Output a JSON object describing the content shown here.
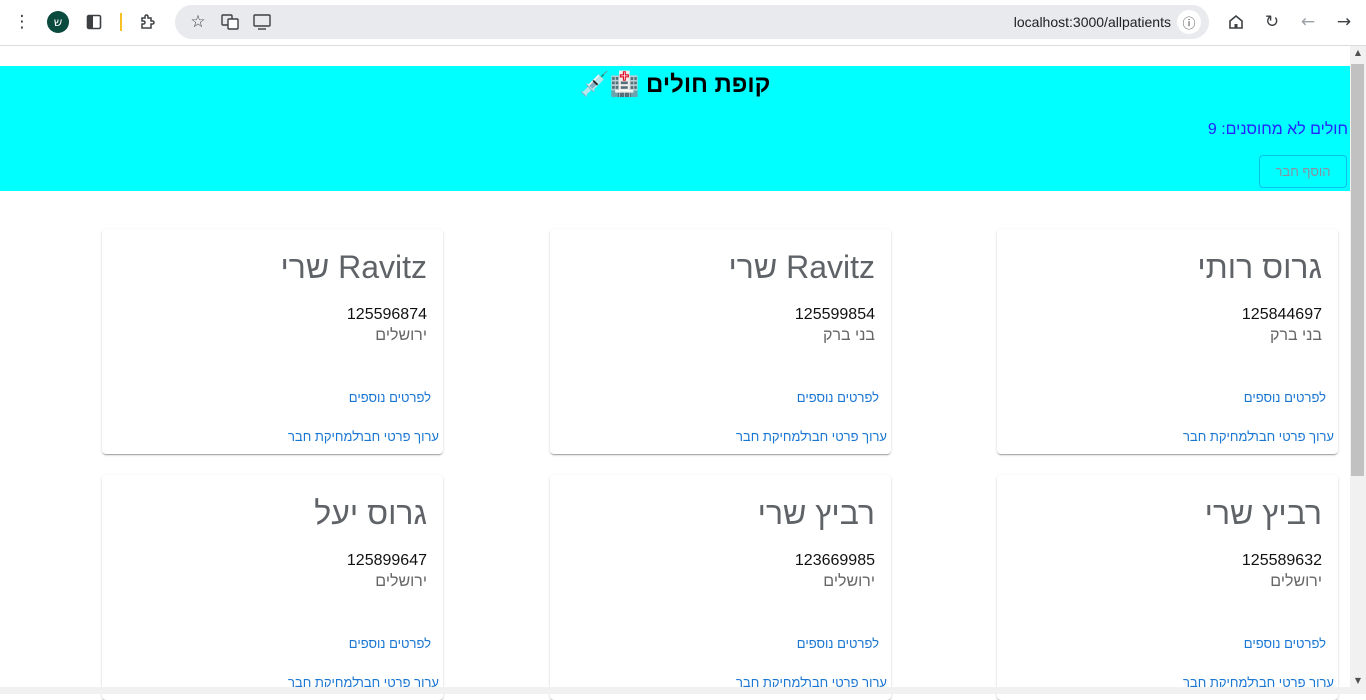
{
  "browser": {
    "url": "localhost:3000/allpatients",
    "profile_initial": "ש",
    "icons": [
      "menu-dots-icon",
      "profile-avatar",
      "sidebar-icon",
      "extensions-icon",
      "bookmark-star-icon",
      "translate-icon",
      "cast-icon",
      "info-icon",
      "home-icon",
      "reload-icon",
      "back-icon",
      "forward-icon"
    ]
  },
  "header": {
    "title": "קופת חולים 🏥💉",
    "unvaccinated_label": "חולים לא מחוסנים: 9",
    "add_button": "הוסף חבר",
    "background": "#00ffff"
  },
  "cards": [
    {
      "name": "גרוס רותי",
      "id": "125844697",
      "city": "בני ברק",
      "more": "לפרטים נוספים",
      "edit": "ערוך פרטי חבר",
      "delete": "למחיקת חבר"
    },
    {
      "name": "Ravitz שרי",
      "id": "125599854",
      "city": "בני ברק",
      "more": "לפרטים נוספים",
      "edit": "ערוך פרטי חבר",
      "delete": "למחיקת חבר"
    },
    {
      "name": "Ravitz שרי",
      "id": "125596874",
      "city": "ירושלים",
      "more": "לפרטים נוספים",
      "edit": "ערוך פרטי חבר",
      "delete": "למחיקת חבר"
    },
    {
      "name": "רביץ שרי",
      "id": "125589632",
      "city": "ירושלים",
      "more": "לפרטים נוספים",
      "edit": "ערוך פרטי חבר",
      "delete": "למחיקת חבר"
    },
    {
      "name": "רביץ שרי",
      "id": "123669985",
      "city": "ירושלים",
      "more": "לפרטים נוספים",
      "edit": "ערוך פרטי חבר",
      "delete": "למחיקת חבר"
    },
    {
      "name": "גרוס יעל",
      "id": "125899647",
      "city": "ירושלים",
      "more": "לפרטים נוספים",
      "edit": "ערוך פרטי חבר",
      "delete": "למחיקת חבר"
    }
  ]
}
